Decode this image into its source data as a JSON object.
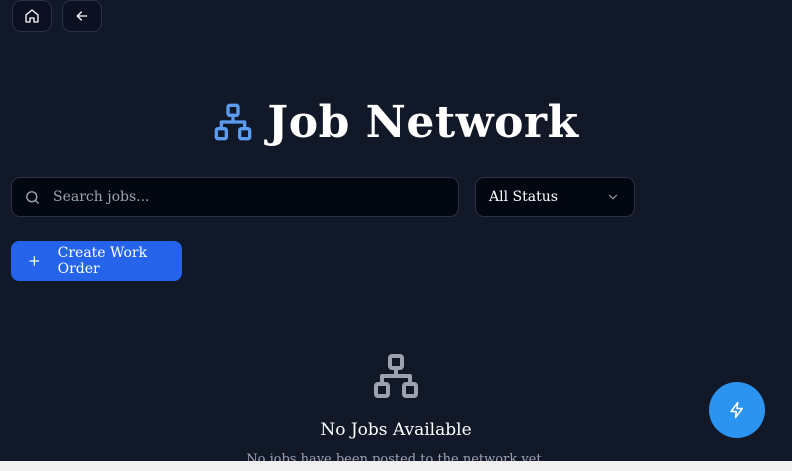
{
  "nav": {
    "home_icon": "home-icon",
    "back_icon": "arrow-left-icon"
  },
  "header": {
    "title": "Job Network",
    "icon": "network-icon",
    "accent_color": "#5b9cf0"
  },
  "filters": {
    "search_placeholder": "Search jobs...",
    "status_selected": "All Status"
  },
  "actions": {
    "create_label": "Create Work Order"
  },
  "empty_state": {
    "title": "No Jobs Available",
    "subtitle": "No jobs have been posted to the network yet."
  },
  "fab": {
    "icon": "zap-icon",
    "color": "#2b93f0"
  }
}
